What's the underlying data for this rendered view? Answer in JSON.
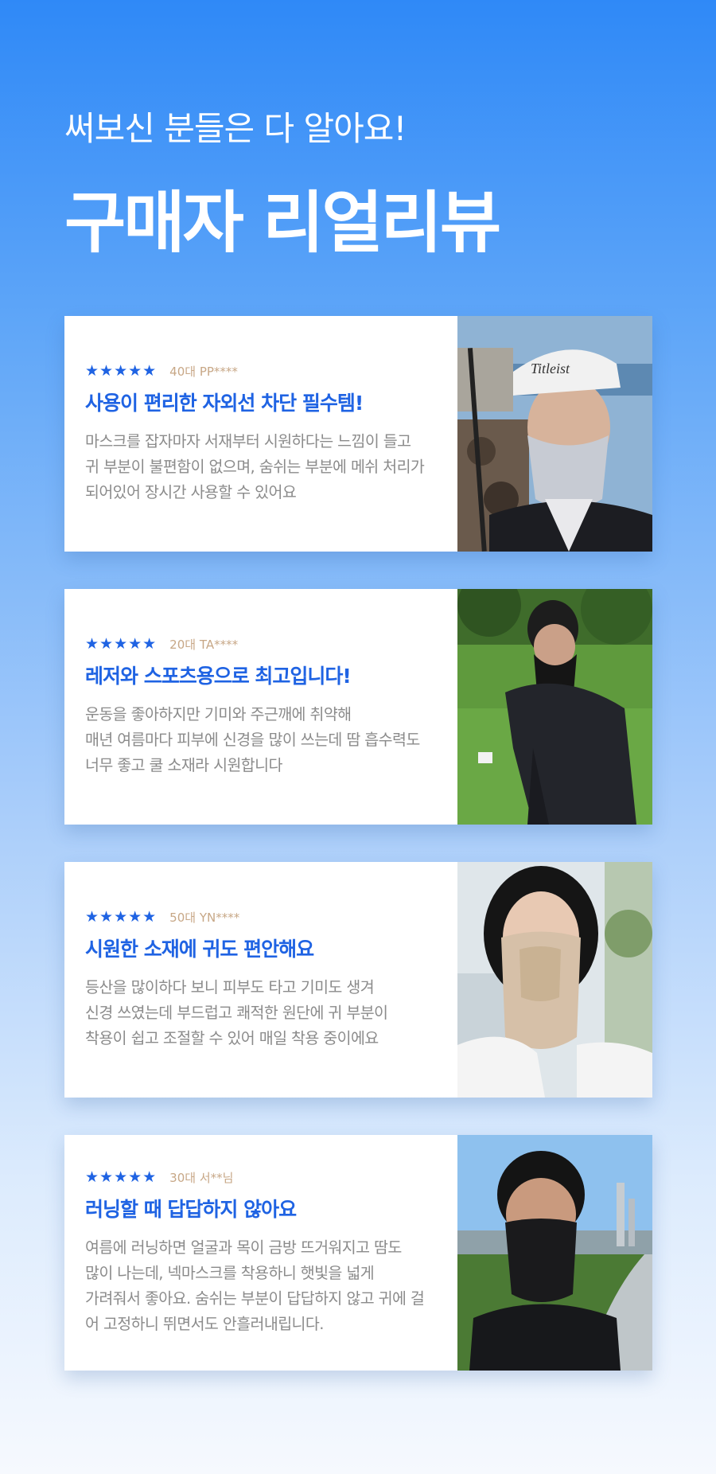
{
  "hero": {
    "subtitle": "써보신 분들은 다 알아요!",
    "title": "구매자 리얼리뷰"
  },
  "colors": {
    "accent": "#1f63e3",
    "reviewer_meta": "#c7a786",
    "body_text": "#8b8b8b"
  },
  "reviews": [
    {
      "stars": "★★★★★",
      "rating": 5,
      "reviewer": "40대 PP****",
      "headline": "사용이 편리한 자외선 차단 필수템!",
      "lines": [
        "마스크를 잡자마자 서재부터 시원하다는 느낌이 들고",
        "귀 부분이 불편함이 없으며, 숨쉬는 부분에 메쉬 처리가",
        "되어있어 장시간 사용할 수 있어요"
      ],
      "photo": "woman-golf-visor-gray-neck-mask"
    },
    {
      "stars": "★★★★★",
      "rating": 5,
      "reviewer": "20대 TA****",
      "headline": "레저와 스포츠용으로 최고입니다!",
      "lines": [
        "운동을 좋아하지만 기미와 주근깨에 취약해",
        "매년 여름마다 피부에 신경을 많이 쓰는데 땀 흡수력도",
        "너무 좋고 쿨 소재라 시원합니다"
      ],
      "photo": "man-golfing-black-neck-mask"
    },
    {
      "stars": "★★★★★",
      "rating": 5,
      "reviewer": "50대 YN****",
      "headline": "시원한 소재에 귀도 편안해요",
      "lines": [
        "등산을 많이하다 보니 피부도 타고 기미도 생겨",
        "신경 쓰였는데 부드럽고 쾌적한 원단에 귀 부분이",
        "착용이 쉽고 조절할 수 있어 매일 착용 중이에요"
      ],
      "photo": "woman-beige-neck-mask"
    },
    {
      "stars": "★★★★★",
      "rating": 5,
      "reviewer": "30대 서**님",
      "headline": "러닝할 때 답답하지 않아요",
      "lines": [
        "여름에 러닝하면 얼굴과 목이 금방 뜨거워지고 땀도",
        "많이 나는데, 넥마스크를 착용하니 햇빛을 넓게",
        "가려줘서 좋아요. 숨쉬는 부분이 답답하지 않고 귀에 걸",
        "어 고정하니 뛰면서도 안흘러내립니다."
      ],
      "photo": "man-running-black-neck-mask"
    }
  ]
}
